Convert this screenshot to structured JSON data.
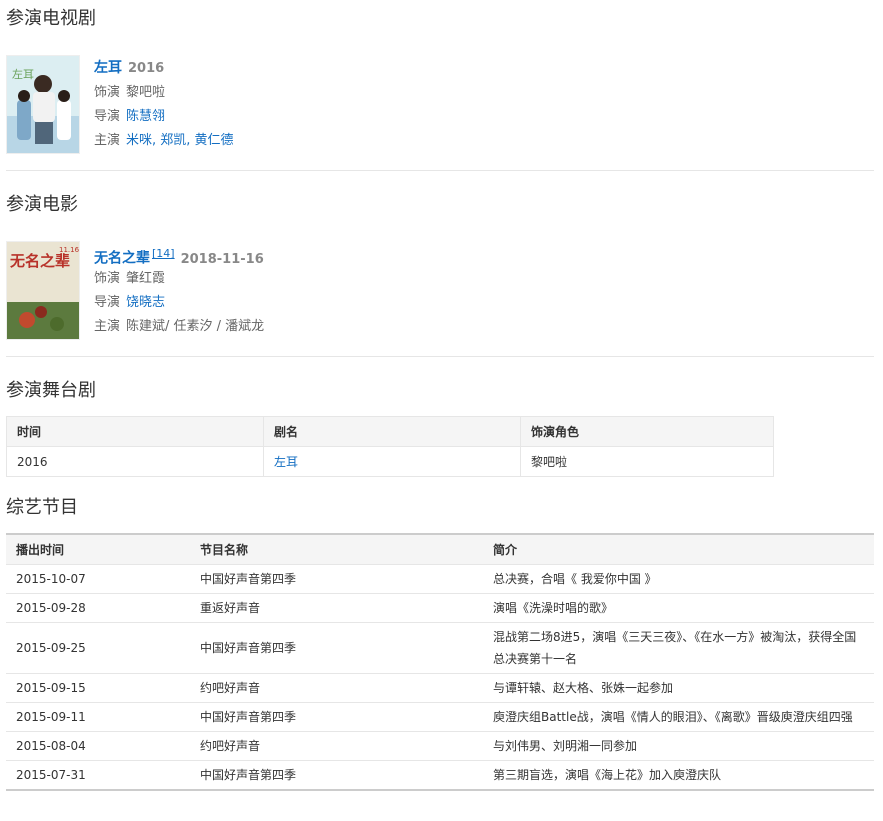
{
  "tv": {
    "heading": "参演电视剧",
    "item": {
      "title": "左耳",
      "year": "2016",
      "role_label": "饰演",
      "role": "黎吧啦",
      "director_label": "导演",
      "director": "陈慧翎",
      "cast_label": "主演",
      "cast": "米咪, 郑凯, 黄仁德",
      "poster_text": "左耳"
    }
  },
  "film": {
    "heading": "参演电影",
    "item": {
      "title": "无名之辈",
      "ref": "[14]",
      "year": "2018-11-16",
      "role_label": "饰演",
      "role": "肇红霞",
      "director_label": "导演",
      "director": "饶晓志",
      "cast_label": "主演",
      "cast": "陈建斌/ 任素汐 / 潘斌龙",
      "poster_text": "无名之辈",
      "poster_date": "11.16"
    }
  },
  "stage": {
    "heading": "参演舞台剧",
    "headers": [
      "时间",
      "剧名",
      "饰演角色"
    ],
    "rows": [
      [
        "2016",
        "左耳",
        "黎吧啦"
      ]
    ]
  },
  "variety": {
    "heading": "综艺节目",
    "headers": [
      "播出时间",
      "节目名称",
      "简介"
    ],
    "rows": [
      [
        "2015-10-07",
        "中国好声音第四季",
        "总决赛，合唱《 我爱你中国 》"
      ],
      [
        "2015-09-28",
        "重返好声音",
        "演唱《洗澡时唱的歌》"
      ],
      [
        "2015-09-25",
        "中国好声音第四季",
        "混战第二场8进5，演唱《三天三夜》、《在水一方》被淘汰，获得全国总决赛第十一名"
      ],
      [
        "2015-09-15",
        "约吧好声音",
        "与谭轩辕、赵大格、张姝一起参加"
      ],
      [
        "2015-09-11",
        "中国好声音第四季",
        "庾澄庆组Battle战，演唱《情人的眼泪》、《离歌》晋级庾澄庆组四强"
      ],
      [
        "2015-08-04",
        "约吧好声音",
        "与刘伟男、刘明湘一同参加"
      ],
      [
        "2015-07-31",
        "中国好声音第四季",
        "第三期盲选，演唱《海上花》加入庾澄庆队"
      ]
    ]
  },
  "colors": {
    "link": "#136ec2",
    "header_bg": "#f5f5f5",
    "border": "#e6e6e6"
  }
}
